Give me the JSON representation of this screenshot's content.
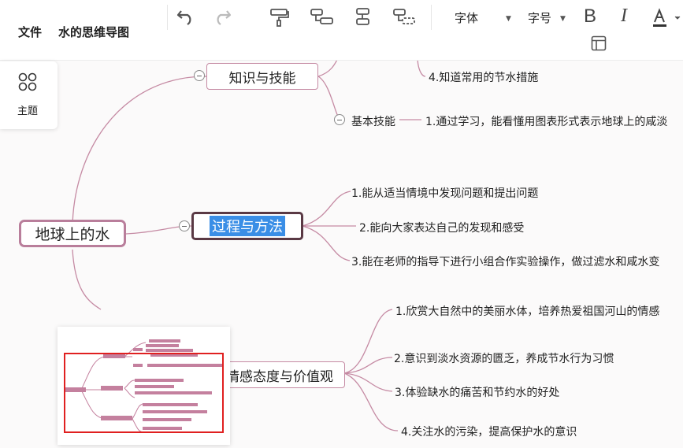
{
  "toolbar": {
    "file_menu": "文件",
    "doc_title": "水的思维导图",
    "font_label": "字体",
    "size_label": "字号",
    "accent_color": "#333333",
    "icons": [
      "undo-icon",
      "redo-icon",
      "format-painter-icon",
      "child-topic-icon",
      "sibling-topic-icon",
      "free-topic-icon",
      "bold-icon",
      "italic-icon",
      "font-color-icon",
      "layout-icon"
    ]
  },
  "side_panel": {
    "label": "主题",
    "icon": "theme-grid-icon"
  },
  "mindmap": {
    "root": "地球上的水",
    "branches": {
      "knowledge": "知识与技能",
      "process": "过程与方法",
      "attitude": "情感态度与价值观"
    },
    "knowledge_items": {
      "item4": "4.知道常用的节水措施",
      "basic_skill": "基本技能",
      "basic_skill_item1": "1.通过学习，能看懂用图表形式表示地球上的咸淡"
    },
    "process_items": [
      "1.能从适当情境中发现问题和提出问题",
      "2.能向大家表达自己的发现和感受",
      "3.能在老师的指导下进行小组合作实验操作，做过滤水和咸水变"
    ],
    "attitude_items": [
      "1.欣赏大自然中的美丽水体，培养热爱祖国河山的情感",
      "2.意识到淡水资源的匮乏，养成节水行为习惯",
      "3.体验缺水的痛苦和节约水的好处",
      "4.关注水的污染，提高保护水的意识"
    ],
    "line_color": "#c58aa3",
    "selected_color": "#3a8ee6"
  },
  "minimap": {
    "viewport_color": "#e02020",
    "node_color": "#c4809e"
  }
}
